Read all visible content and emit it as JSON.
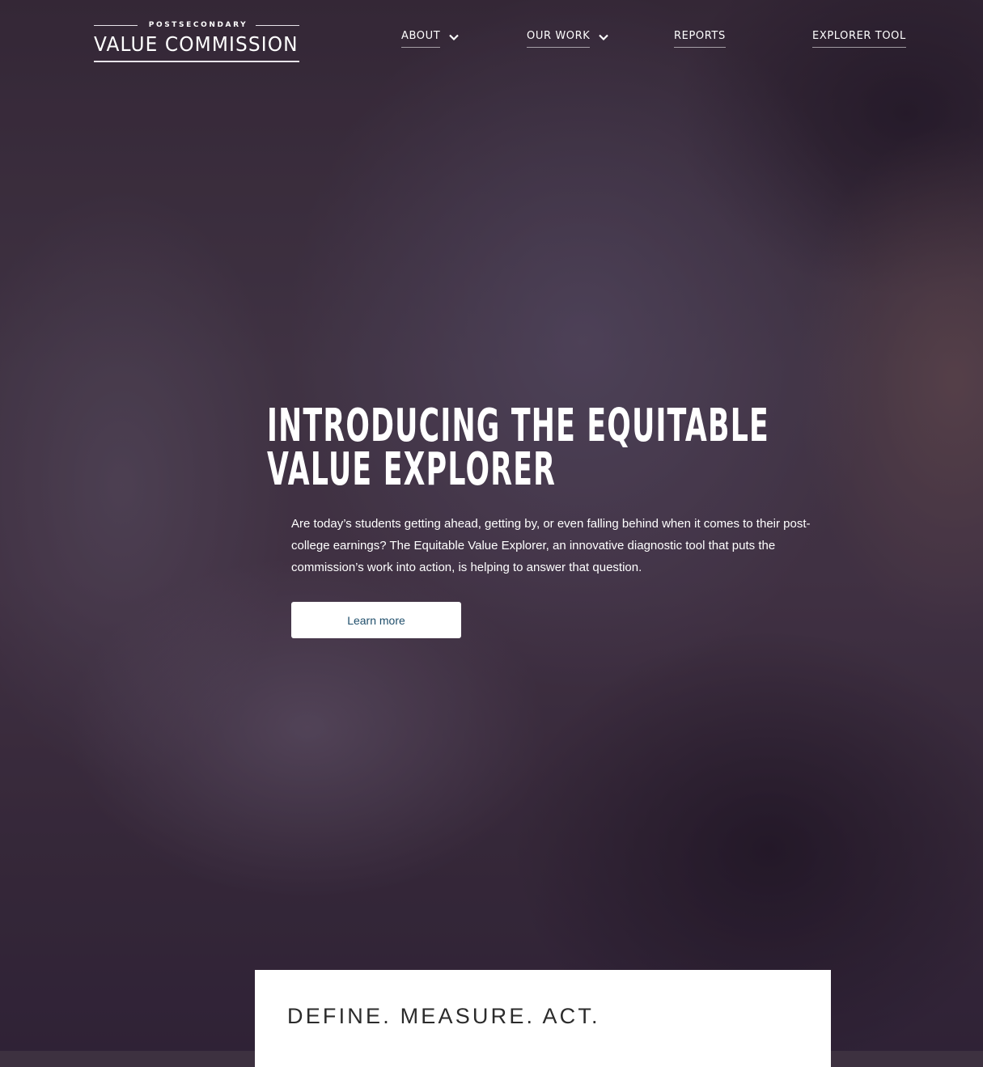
{
  "logo": {
    "small_text": "POSTSECONDARY",
    "main_text": "VALUE COMMISSION"
  },
  "nav": {
    "items": [
      {
        "label": "ABOUT",
        "icon": "chevron-down-icon"
      },
      {
        "label": "OUR WORK",
        "icon": "chevron-down-icon"
      },
      {
        "label": "REPORTS"
      },
      {
        "label": "EXPLORER TOOL"
      }
    ]
  },
  "hero": {
    "title": "INTRODUCING THE EQUITABLE VALUE EXPLORER",
    "description": "Are today’s students getting ahead, getting by, or even falling behind when it comes to their post-college earnings? The Equitable Value Explorer, an innovative diagnostic tool that puts the commission’s work into action, is helping to answer that question.",
    "button_label": "Learn more"
  },
  "section": {
    "heading": "DEFINE. MEASURE. ACT."
  },
  "colors": {
    "button_text": "#1f4e6b",
    "hero_overlay": "#3d3140",
    "card_background": "#ffffff",
    "heading_text": "#2b2b2b"
  }
}
